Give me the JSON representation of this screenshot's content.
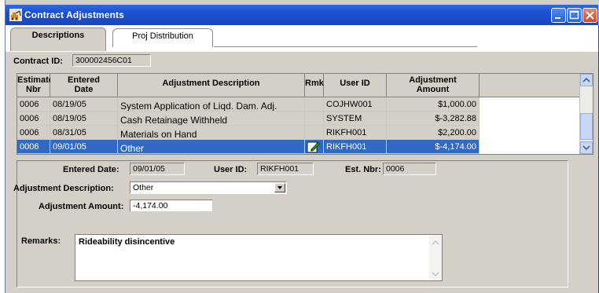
{
  "window": {
    "title": "Contract Adjustments",
    "title_icon": "excavator-icon"
  },
  "tabs": [
    {
      "label": "Descriptions",
      "active": true
    },
    {
      "label": "Proj Distribution",
      "active": false
    }
  ],
  "contract": {
    "label": "Contract ID:",
    "value": "300002456C01"
  },
  "grid": {
    "headers": {
      "estimate": [
        "Estimate",
        "Nbr"
      ],
      "entered": [
        "Entered",
        "Date"
      ],
      "description": "Adjustment Description",
      "rmk": "Rmk",
      "user": "User ID",
      "amount": [
        "Adjustment",
        "Amount"
      ]
    },
    "rows": [
      {
        "estimate": "0006",
        "entered": "08/19/05",
        "description": "System Application of Liqd. Dam. Adj.",
        "rmk": "",
        "user": "COJHW001",
        "amount": "$1,000.00",
        "selected": false
      },
      {
        "estimate": "0006",
        "entered": "08/19/05",
        "description": "Cash Retainage Withheld",
        "rmk": "",
        "user": "SYSTEM",
        "amount": "$-3,282.88",
        "selected": false
      },
      {
        "estimate": "0006",
        "entered": "08/31/05",
        "description": "Materials on Hand",
        "rmk": "",
        "user": "RIKFH001",
        "amount": "$2,200.00",
        "selected": false
      },
      {
        "estimate": "0006",
        "entered": "09/01/05",
        "description": "Other",
        "rmk": "edit-note-icon",
        "user": "RIKFH001",
        "amount": "$-4,174.00",
        "selected": true
      }
    ]
  },
  "detail": {
    "entered_date": {
      "label": "Entered Date:",
      "value": "09/01/05"
    },
    "user_id": {
      "label": "User ID:",
      "value": "RIKFH001"
    },
    "est_nbr": {
      "label": "Est. Nbr:",
      "value": "0006"
    },
    "adj_desc": {
      "label": "Adjustment Description:",
      "value": "Other"
    },
    "adj_amount": {
      "label": "Adjustment Amount:",
      "value": "-4,174.00"
    },
    "remarks": {
      "label": "Remarks:",
      "value": "Rideability disincentive"
    }
  }
}
